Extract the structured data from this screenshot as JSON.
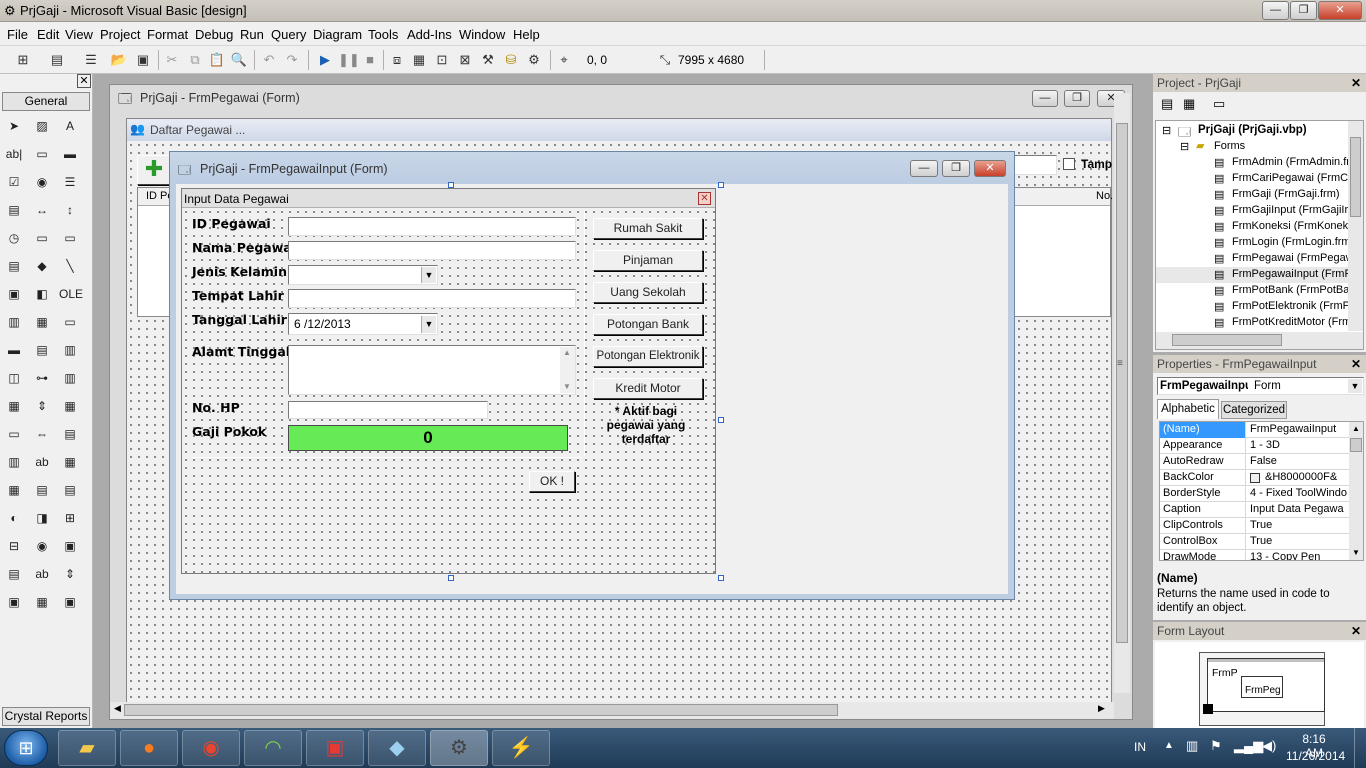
{
  "app": {
    "title": "PrjGaji - Microsoft Visual Basic [design]"
  },
  "menu": [
    "File",
    "Edit",
    "View",
    "Project",
    "Format",
    "Debug",
    "Run",
    "Query",
    "Diagram",
    "Tools",
    "Add-Ins",
    "Window",
    "Help"
  ],
  "toolbar": {
    "position": "0, 0",
    "size": "7995 x 4680"
  },
  "toolbox": {
    "tab_general": "General",
    "tab_crystal": "Crystal Reports"
  },
  "mdi": {
    "form_window_title": "PrjGaji - FrmPegawai (Form)",
    "daftar_caption": "Daftar Pegawai ...",
    "grid_col_id": "ID Pe",
    "grid_col_no": "No.",
    "checkbox_label": "Tamp"
  },
  "input_window": {
    "title": "PrjGaji - FrmPegawaiInput (Form)",
    "form_caption": "Input Data Pegawai",
    "labels": {
      "id": "ID Pegawai",
      "nama": "Nama Pegawai",
      "jenis": "Jenis Kelamin",
      "tempat": "Tempat Lahir",
      "tanggal": "Tanggal Lahir",
      "alamat": "Alamt Tinggal",
      "hp": "No. HP",
      "gaji": "Gaji Pokok"
    },
    "date_value": "6 /12/2013",
    "gaji_value": "0",
    "buttons": [
      "Rumah Sakit",
      "Pinjaman",
      "Uang Sekolah",
      "Potongan Bank",
      "Potongan Elektronik",
      "Kredit Motor"
    ],
    "note": "* Aktif bagi pegawai yang terdaftar",
    "ok_label": "OK !"
  },
  "project": {
    "title": "Project - PrjGaji",
    "root": "PrjGaji (PrjGaji.vbp)",
    "folder": "Forms",
    "items": [
      "FrmAdmin (FrmAdmin.fr",
      "FrmCariPegawai (FrmCa",
      "FrmGaji (FrmGaji.frm)",
      "FrmGajiInput (FrmGajiIr",
      "FrmKoneksi (FrmKoneks",
      "FrmLogin (FrmLogin.frm",
      "FrmPegawai (FrmPegaw",
      "FrmPegawaiInput (FrmP",
      "FrmPotBank (FrmPotBar",
      "FrmPotElektronik (FrmP",
      "FrmPotKreditMotor (Frm"
    ]
  },
  "properties": {
    "title": "Properties - FrmPegawaiInput",
    "object_name": "FrmPegawaiInpu",
    "object_type": "Form",
    "tab_alpha": "Alphabetic",
    "tab_cat": "Categorized",
    "rows": [
      {
        "name": "(Name)",
        "value": "FrmPegawaiInput"
      },
      {
        "name": "Appearance",
        "value": "1 - 3D"
      },
      {
        "name": "AutoRedraw",
        "value": "False"
      },
      {
        "name": "BackColor",
        "value": "&H8000000F&"
      },
      {
        "name": "BorderStyle",
        "value": "4 - Fixed ToolWindo"
      },
      {
        "name": "Caption",
        "value": "Input Data Pegawa"
      },
      {
        "name": "ClipControls",
        "value": "True"
      },
      {
        "name": "ControlBox",
        "value": "True"
      },
      {
        "name": "DrawMode",
        "value": "13 - Copy Pen"
      }
    ],
    "desc_title": "(Name)",
    "desc_text": "Returns the name used in code to identify an object."
  },
  "form_layout": {
    "title": "Form Layout",
    "label1": "FrmP",
    "label2": "FrmPeg"
  },
  "taskbar": {
    "lang": "IN",
    "time": "8:16 AM",
    "date": "11/26/2014"
  }
}
